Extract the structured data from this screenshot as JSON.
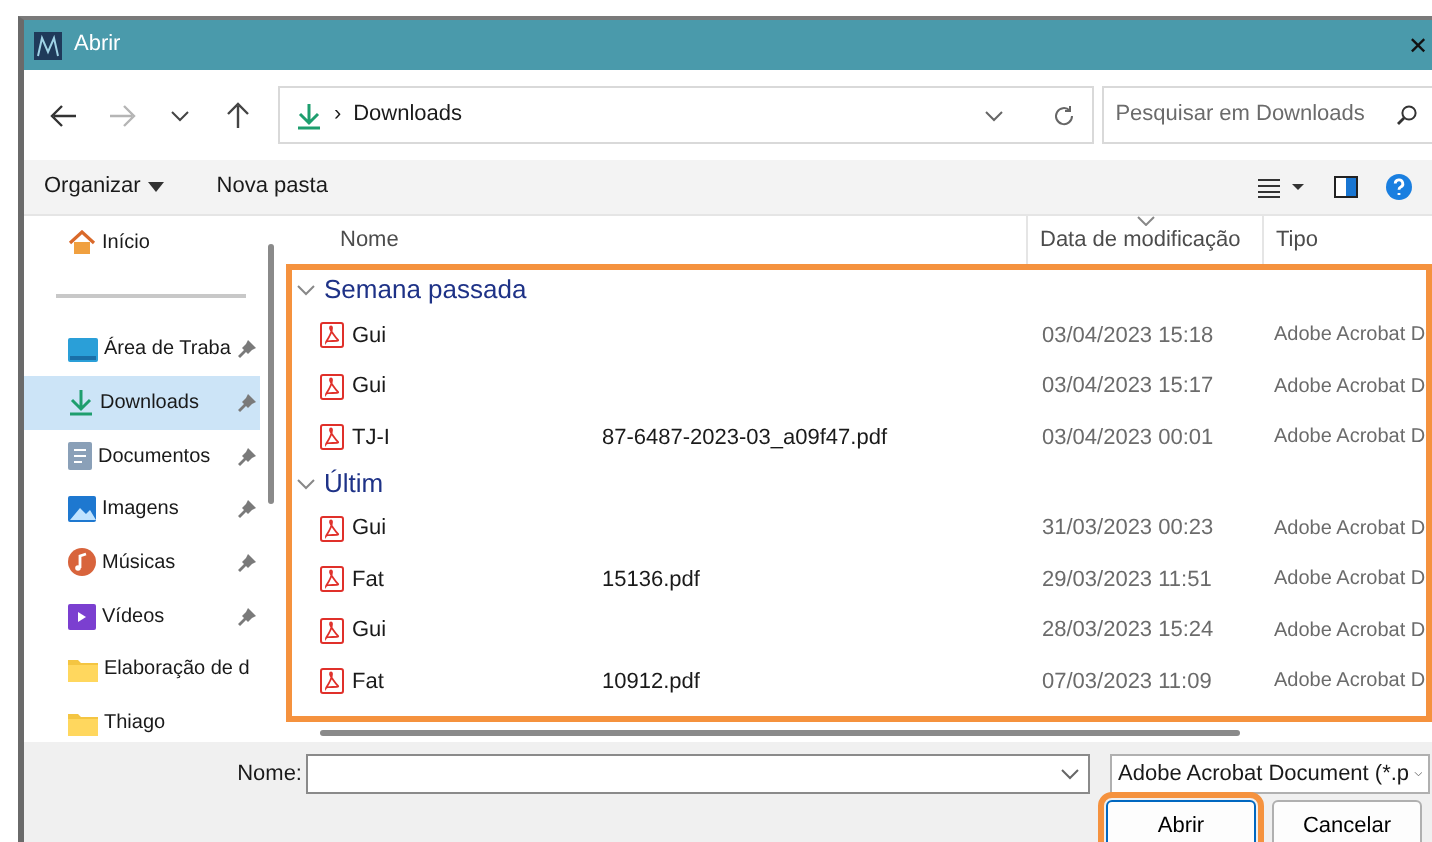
{
  "window": {
    "title": "Abrir",
    "close": "✕"
  },
  "navigation": {
    "back_enabled": true,
    "forward_enabled": false
  },
  "address": {
    "separator": "›",
    "location": "Downloads"
  },
  "search": {
    "placeholder": "Pesquisar em Downloads"
  },
  "toolbar": {
    "organize": "Organizar",
    "new_folder": "Nova pasta"
  },
  "sidebar": {
    "items": [
      {
        "kind": "item",
        "label": "Início",
        "pinned": false,
        "selected": false
      },
      {
        "kind": "divider"
      },
      {
        "kind": "item",
        "label": "Área de Traba",
        "pinned": true,
        "selected": false
      },
      {
        "kind": "item",
        "label": "Downloads",
        "pinned": true,
        "selected": true
      },
      {
        "kind": "item",
        "label": "Documentos",
        "pinned": true,
        "selected": false
      },
      {
        "kind": "item",
        "label": "Imagens",
        "pinned": true,
        "selected": false
      },
      {
        "kind": "item",
        "label": "Músicas",
        "pinned": true,
        "selected": false
      },
      {
        "kind": "item",
        "label": "Vídeos",
        "pinned": true,
        "selected": false
      },
      {
        "kind": "item",
        "label": "Elaboração de d",
        "pinned": false,
        "selected": false
      },
      {
        "kind": "item",
        "label": "Thiago",
        "pinned": false,
        "selected": false
      }
    ]
  },
  "columns": [
    {
      "label": "Nome",
      "sorted": false
    },
    {
      "label": "Data de modificação",
      "sorted": true
    },
    {
      "label": "Tipo",
      "sorted": false
    }
  ],
  "file_list": {
    "highlighted": true,
    "groups": [
      {
        "label": "Semana passada",
        "expanded": true,
        "files": [
          {
            "name": "Gui",
            "date": "03/04/2023 15:18",
            "type": "Adobe Acrobat D"
          },
          {
            "name": "Gui",
            "date": "03/04/2023 15:17",
            "type": "Adobe Acrobat D"
          },
          {
            "name": "TJ-I",
            "name_end": "87-6487-2023-03_a09f47.pdf",
            "date": "03/04/2023 00:01",
            "type": "Adobe Acrobat D"
          }
        ]
      },
      {
        "label": "Últim",
        "expanded": true,
        "files": [
          {
            "name": "Gui",
            "date": "31/03/2023 00:23",
            "type": "Adobe Acrobat D"
          },
          {
            "name": "Fat",
            "name_end": "15136.pdf",
            "date": "29/03/2023 11:51",
            "type": "Adobe Acrobat D"
          },
          {
            "name": "Gui",
            "date": "28/03/2023 15:24",
            "type": "Adobe Acrobat D"
          },
          {
            "name": "Fat",
            "name_end": "10912.pdf",
            "date": "07/03/2023 11:09",
            "type": "Adobe Acrobat D"
          }
        ]
      }
    ]
  },
  "footer": {
    "name_label": "Nome:",
    "file_type": "Adobe Acrobat Document (*.p",
    "buttons": [
      {
        "label": "Abrir",
        "highlighted": true
      },
      {
        "label": "Cancelar",
        "highlighted": false
      }
    ]
  }
}
